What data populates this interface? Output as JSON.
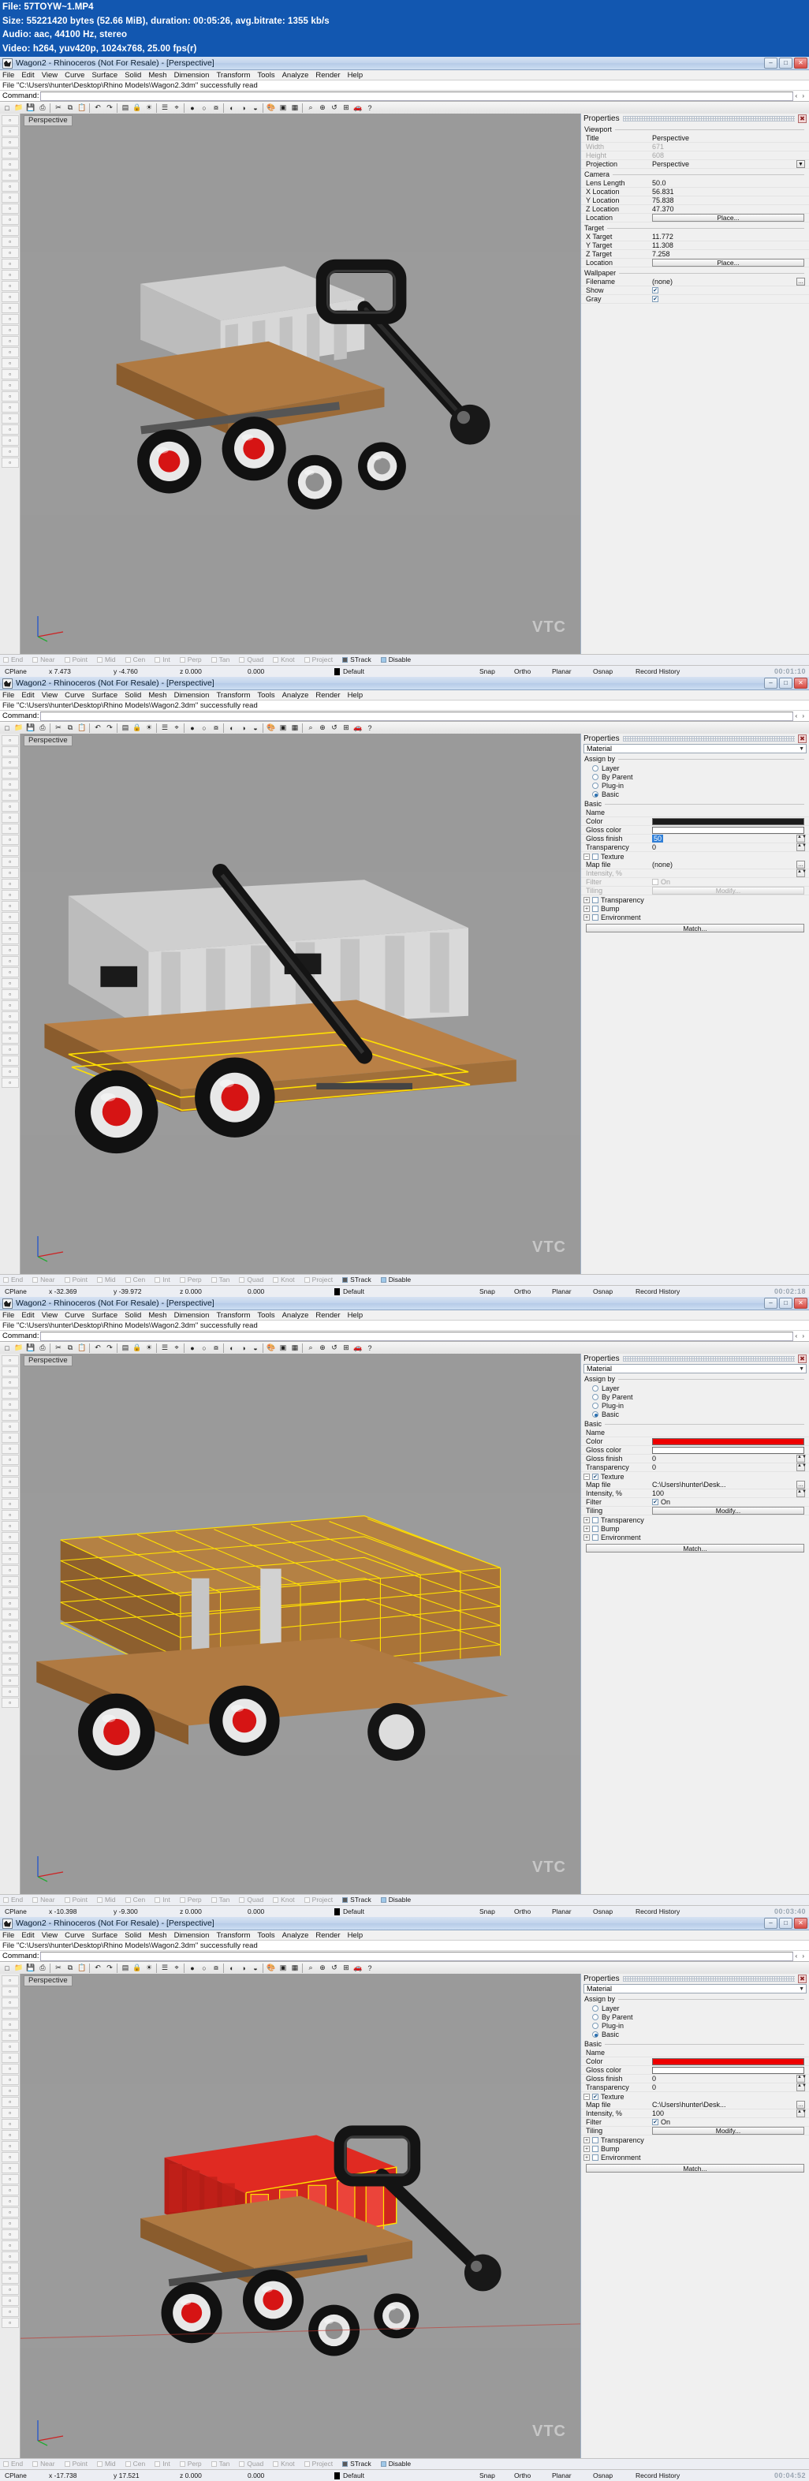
{
  "mediainfo": {
    "line1": "File: 57TOYW~1.MP4",
    "line2": "Size: 55221420 bytes (52.66 MiB), duration: 00:05:26, avg.bitrate: 1355 kb/s",
    "line3": "Audio: aac, 44100 Hz, stereo",
    "line4": "Video: h264, yuv420p, 1024x768, 25.00 fps(r)"
  },
  "menu": [
    "File",
    "Edit",
    "View",
    "Curve",
    "Surface",
    "Solid",
    "Mesh",
    "Dimension",
    "Transform",
    "Tools",
    "Analyze",
    "Render",
    "Help"
  ],
  "osnap": {
    "items": [
      {
        "label": "End",
        "state": "off"
      },
      {
        "label": "Near",
        "state": "off"
      },
      {
        "label": "Point",
        "state": "off"
      },
      {
        "label": "Mid",
        "state": "off"
      },
      {
        "label": "Cen",
        "state": "off"
      },
      {
        "label": "Int",
        "state": "off"
      },
      {
        "label": "Perp",
        "state": "off"
      },
      {
        "label": "Tan",
        "state": "off"
      },
      {
        "label": "Quad",
        "state": "off"
      },
      {
        "label": "Knot",
        "state": "off"
      },
      {
        "label": "Project",
        "state": "off"
      },
      {
        "label": "STrack",
        "state": "dark"
      },
      {
        "label": "Disable",
        "state": "blue"
      }
    ]
  },
  "statusbar_common": {
    "cplane": "CPlane",
    "z": "z 0.000",
    "extra": "0.000",
    "layer": "Default",
    "snap": "Snap",
    "ortho": "Ortho",
    "planar": "Planar",
    "osnap": "Osnap",
    "record": "Record History"
  },
  "panels": [
    {
      "title": "Wagon2 - Rhinoceros (Not For Resale) - [Perspective]",
      "filebar": "File \"C:\\Users\\hunter\\Desktop\\Rhino Models\\Wagon2.3dm\" successfully read",
      "command_label": "Command:",
      "viewport_label": "Perspective",
      "watermark": "VTC",
      "status": {
        "x": "x 7.473",
        "y": "y -4.760"
      },
      "timecode": "00:01:10",
      "properties": {
        "header": "Properties",
        "close": "✖",
        "sections": [
          {
            "name": "Viewport",
            "rows": [
              {
                "k": "Title",
                "v": "Perspective",
                "type": "text"
              },
              {
                "k": "Width",
                "v": "671",
                "type": "text",
                "dim": true
              },
              {
                "k": "Height",
                "v": "608",
                "type": "text",
                "dim": true
              },
              {
                "k": "Projection",
                "v": "Perspective",
                "type": "dropdown"
              }
            ]
          },
          {
            "name": "Camera",
            "rows": [
              {
                "k": "Lens Length",
                "v": "50.0",
                "type": "text"
              },
              {
                "k": "X Location",
                "v": "56.831",
                "type": "text"
              },
              {
                "k": "Y Location",
                "v": "75.838",
                "type": "text"
              },
              {
                "k": "Z Location",
                "v": "47.370",
                "type": "text"
              },
              {
                "k": "Location",
                "v": "Place...",
                "type": "button"
              }
            ]
          },
          {
            "name": "Target",
            "rows": [
              {
                "k": "X Target",
                "v": "11.772",
                "type": "text"
              },
              {
                "k": "Y Target",
                "v": "11.308",
                "type": "text"
              },
              {
                "k": "Z Target",
                "v": "7.258",
                "type": "text"
              },
              {
                "k": "Location",
                "v": "Place...",
                "type": "button"
              }
            ]
          },
          {
            "name": "Wallpaper",
            "rows": [
              {
                "k": "Filename",
                "v": "(none)",
                "type": "file"
              },
              {
                "k": "Show",
                "v": "",
                "type": "checkbox_on"
              },
              {
                "k": "Gray",
                "v": "",
                "type": "checkbox_on"
              }
            ]
          }
        ]
      }
    },
    {
      "title": "Wagon2 - Rhinoceros (Not For Resale) - [Perspective]",
      "filebar": "File \"C:\\Users\\hunter\\Desktop\\Rhino Models\\Wagon2.3dm\" successfully read",
      "command_label": "Command:",
      "viewport_label": "Perspective",
      "watermark": "VTC",
      "status": {
        "x": "x -32.369",
        "y": "y -39.972"
      },
      "timecode": "00:02:18",
      "material": {
        "header": "Properties",
        "combo": "Material",
        "assign_by_label": "Assign by",
        "assign_options": [
          {
            "label": "Layer",
            "selected": false
          },
          {
            "label": "By Parent",
            "selected": false
          },
          {
            "label": "Plug-in",
            "selected": false
          },
          {
            "label": "Basic",
            "selected": true
          }
        ],
        "basic_label": "Basic",
        "name_label": "Name",
        "name_value": "",
        "color_label": "Color",
        "color_value": "#1c1c1c",
        "gloss_color_label": "Gloss color",
        "gloss_color_value": "#ffffff",
        "gloss_finish_label": "Gloss finish",
        "gloss_finish_value": "50",
        "gloss_finish_selected": true,
        "transparency_label": "Transparency",
        "transparency_value": "0",
        "texture_label": "Texture",
        "texture_on": false,
        "map_file_label": "Map file",
        "map_file_value": "(none)",
        "intensity_label": "Intensity, %",
        "intensity_value": "",
        "filter_label": "Filter",
        "filter_value": "On",
        "filter_on": false,
        "tiling_label": "Tiling",
        "tiling_button": "Modify...",
        "sub_sections": [
          "Transparency",
          "Bump",
          "Environment"
        ],
        "match_button": "Match..."
      }
    },
    {
      "title": "Wagon2 - Rhinoceros (Not For Resale) - [Perspective]",
      "filebar": "File \"C:\\Users\\hunter\\Desktop\\Rhino Models\\Wagon2.3dm\" successfully read",
      "command_label": "Command:",
      "viewport_label": "Perspective",
      "watermark": "VTC",
      "status": {
        "x": "x -10.398",
        "y": "y -9.300"
      },
      "timecode": "00:03:40",
      "material": {
        "header": "Properties",
        "combo": "Material",
        "assign_by_label": "Assign by",
        "assign_options": [
          {
            "label": "Layer",
            "selected": false
          },
          {
            "label": "By Parent",
            "selected": false
          },
          {
            "label": "Plug-in",
            "selected": false
          },
          {
            "label": "Basic",
            "selected": true
          }
        ],
        "basic_label": "Basic",
        "name_label": "Name",
        "name_value": "",
        "color_label": "Color",
        "color_value": "#ee0000",
        "gloss_color_label": "Gloss color",
        "gloss_color_value": "#ffffff",
        "gloss_finish_label": "Gloss finish",
        "gloss_finish_value": "0",
        "gloss_finish_selected": false,
        "transparency_label": "Transparency",
        "transparency_value": "0",
        "texture_label": "Texture",
        "texture_on": true,
        "map_file_label": "Map file",
        "map_file_value": "C:\\Users\\hunter\\Desk...",
        "intensity_label": "Intensity, %",
        "intensity_value": "100",
        "filter_label": "Filter",
        "filter_value": "On",
        "filter_on": true,
        "tiling_label": "Tiling",
        "tiling_button": "Modify...",
        "sub_sections": [
          "Transparency",
          "Bump",
          "Environment"
        ],
        "match_button": "Match..."
      }
    },
    {
      "title": "Wagon2 - Rhinoceros (Not For Resale) - [Perspective]",
      "filebar": "File \"C:\\Users\\hunter\\Desktop\\Rhino Models\\Wagon2.3dm\" successfully read",
      "command_label": "Command:",
      "viewport_label": "Perspective",
      "watermark": "VTC",
      "status": {
        "x": "x -17.738",
        "y": "y 17.521"
      },
      "timecode": "00:04:52",
      "material": {
        "header": "Properties",
        "combo": "Material",
        "assign_by_label": "Assign by",
        "assign_options": [
          {
            "label": "Layer",
            "selected": false
          },
          {
            "label": "By Parent",
            "selected": false
          },
          {
            "label": "Plug-in",
            "selected": false
          },
          {
            "label": "Basic",
            "selected": true
          }
        ],
        "basic_label": "Basic",
        "name_label": "Name",
        "name_value": "",
        "color_label": "Color",
        "color_value": "#ee0000",
        "gloss_color_label": "Gloss color",
        "gloss_color_value": "#ffffff",
        "gloss_finish_label": "Gloss finish",
        "gloss_finish_value": "0",
        "gloss_finish_selected": false,
        "transparency_label": "Transparency",
        "transparency_value": "0",
        "texture_label": "Texture",
        "texture_on": true,
        "map_file_label": "Map file",
        "map_file_value": "C:\\Users\\hunter\\Desk...",
        "intensity_label": "Intensity, %",
        "intensity_value": "100",
        "filter_label": "Filter",
        "filter_value": "On",
        "filter_on": true,
        "tiling_label": "Tiling",
        "tiling_button": "Modify...",
        "sub_sections": [
          "Transparency",
          "Bump",
          "Environment"
        ],
        "match_button": "Match..."
      }
    }
  ]
}
